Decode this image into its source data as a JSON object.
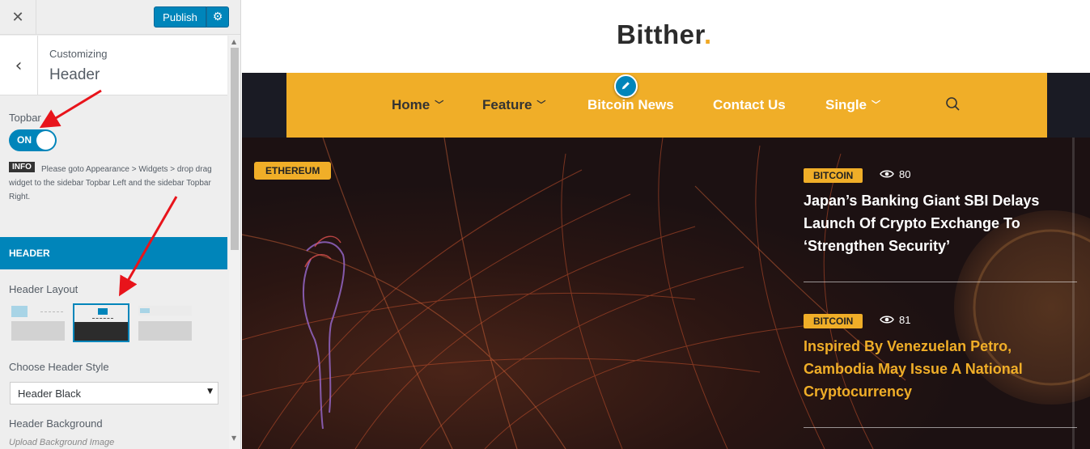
{
  "customizer": {
    "close_icon": "close-icon",
    "publish_label": "Publish",
    "gear_icon": "gear-icon",
    "back_icon": "chevron-left-icon",
    "breadcrumb": "Customizing",
    "title": "Header",
    "topbar_label": "Topbar",
    "topbar_toggle": "ON",
    "info_tag": "INFO",
    "info_text": "Please goto Appearance > Widgets > drop drag widget to the sidebar Topbar Left and the sidebar Topbar Right.",
    "section_header": "HEADER",
    "header_layout_label": "Header Layout",
    "header_layout_selected": 2,
    "choose_style_label": "Choose Header Style",
    "choose_style_value": "Header Black",
    "background_label": "Header Background",
    "background_sub": "Upload Background Image",
    "accent_color": "#0085ba"
  },
  "site": {
    "logo_text": "Bitther",
    "logo_dot": ".",
    "nav": [
      {
        "label": "Home",
        "has_dropdown": true
      },
      {
        "label": "Feature",
        "has_dropdown": true
      },
      {
        "label": "Bitcoin News",
        "has_dropdown": false
      },
      {
        "label": "Contact Us",
        "has_dropdown": false
      },
      {
        "label": "Single",
        "has_dropdown": true
      }
    ],
    "search_icon": "search-icon",
    "edit_icon": "pencil-icon",
    "nav_color": "#f0ae28",
    "hero": {
      "tag": "ETHEREUM",
      "posts": [
        {
          "tag": "BITCOIN",
          "views": "80",
          "title": "Japan’s Banking Giant SBI Delays Launch Of Crypto Exchange To ‘Strengthen Security’"
        },
        {
          "tag": "BITCOIN",
          "views": "81",
          "title": "Inspired By Venezuelan Petro, Cambodia May Issue A National Cryptocurrency"
        }
      ]
    }
  }
}
